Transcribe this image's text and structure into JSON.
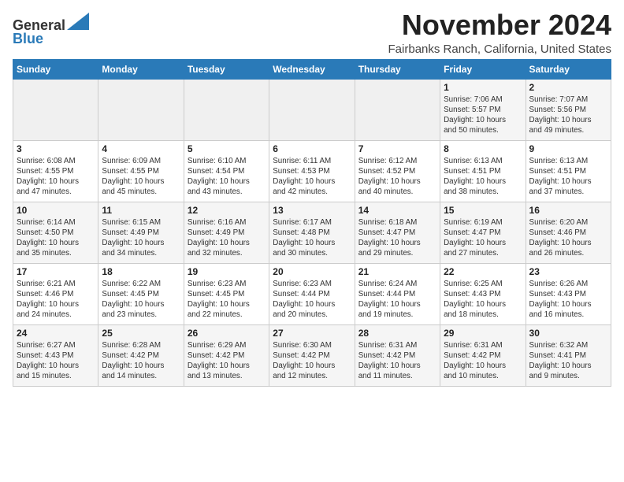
{
  "header": {
    "logo_general": "General",
    "logo_blue": "Blue",
    "month_title": "November 2024",
    "location": "Fairbanks Ranch, California, United States"
  },
  "days_of_week": [
    "Sunday",
    "Monday",
    "Tuesday",
    "Wednesday",
    "Thursday",
    "Friday",
    "Saturday"
  ],
  "weeks": [
    [
      {
        "day": "",
        "info": ""
      },
      {
        "day": "",
        "info": ""
      },
      {
        "day": "",
        "info": ""
      },
      {
        "day": "",
        "info": ""
      },
      {
        "day": "",
        "info": ""
      },
      {
        "day": "1",
        "info": "Sunrise: 7:06 AM\nSunset: 5:57 PM\nDaylight: 10 hours\nand 50 minutes."
      },
      {
        "day": "2",
        "info": "Sunrise: 7:07 AM\nSunset: 5:56 PM\nDaylight: 10 hours\nand 49 minutes."
      }
    ],
    [
      {
        "day": "3",
        "info": "Sunrise: 6:08 AM\nSunset: 4:55 PM\nDaylight: 10 hours\nand 47 minutes."
      },
      {
        "day": "4",
        "info": "Sunrise: 6:09 AM\nSunset: 4:55 PM\nDaylight: 10 hours\nand 45 minutes."
      },
      {
        "day": "5",
        "info": "Sunrise: 6:10 AM\nSunset: 4:54 PM\nDaylight: 10 hours\nand 43 minutes."
      },
      {
        "day": "6",
        "info": "Sunrise: 6:11 AM\nSunset: 4:53 PM\nDaylight: 10 hours\nand 42 minutes."
      },
      {
        "day": "7",
        "info": "Sunrise: 6:12 AM\nSunset: 4:52 PM\nDaylight: 10 hours\nand 40 minutes."
      },
      {
        "day": "8",
        "info": "Sunrise: 6:13 AM\nSunset: 4:51 PM\nDaylight: 10 hours\nand 38 minutes."
      },
      {
        "day": "9",
        "info": "Sunrise: 6:13 AM\nSunset: 4:51 PM\nDaylight: 10 hours\nand 37 minutes."
      }
    ],
    [
      {
        "day": "10",
        "info": "Sunrise: 6:14 AM\nSunset: 4:50 PM\nDaylight: 10 hours\nand 35 minutes."
      },
      {
        "day": "11",
        "info": "Sunrise: 6:15 AM\nSunset: 4:49 PM\nDaylight: 10 hours\nand 34 minutes."
      },
      {
        "day": "12",
        "info": "Sunrise: 6:16 AM\nSunset: 4:49 PM\nDaylight: 10 hours\nand 32 minutes."
      },
      {
        "day": "13",
        "info": "Sunrise: 6:17 AM\nSunset: 4:48 PM\nDaylight: 10 hours\nand 30 minutes."
      },
      {
        "day": "14",
        "info": "Sunrise: 6:18 AM\nSunset: 4:47 PM\nDaylight: 10 hours\nand 29 minutes."
      },
      {
        "day": "15",
        "info": "Sunrise: 6:19 AM\nSunset: 4:47 PM\nDaylight: 10 hours\nand 27 minutes."
      },
      {
        "day": "16",
        "info": "Sunrise: 6:20 AM\nSunset: 4:46 PM\nDaylight: 10 hours\nand 26 minutes."
      }
    ],
    [
      {
        "day": "17",
        "info": "Sunrise: 6:21 AM\nSunset: 4:46 PM\nDaylight: 10 hours\nand 24 minutes."
      },
      {
        "day": "18",
        "info": "Sunrise: 6:22 AM\nSunset: 4:45 PM\nDaylight: 10 hours\nand 23 minutes."
      },
      {
        "day": "19",
        "info": "Sunrise: 6:23 AM\nSunset: 4:45 PM\nDaylight: 10 hours\nand 22 minutes."
      },
      {
        "day": "20",
        "info": "Sunrise: 6:23 AM\nSunset: 4:44 PM\nDaylight: 10 hours\nand 20 minutes."
      },
      {
        "day": "21",
        "info": "Sunrise: 6:24 AM\nSunset: 4:44 PM\nDaylight: 10 hours\nand 19 minutes."
      },
      {
        "day": "22",
        "info": "Sunrise: 6:25 AM\nSunset: 4:43 PM\nDaylight: 10 hours\nand 18 minutes."
      },
      {
        "day": "23",
        "info": "Sunrise: 6:26 AM\nSunset: 4:43 PM\nDaylight: 10 hours\nand 16 minutes."
      }
    ],
    [
      {
        "day": "24",
        "info": "Sunrise: 6:27 AM\nSunset: 4:43 PM\nDaylight: 10 hours\nand 15 minutes."
      },
      {
        "day": "25",
        "info": "Sunrise: 6:28 AM\nSunset: 4:42 PM\nDaylight: 10 hours\nand 14 minutes."
      },
      {
        "day": "26",
        "info": "Sunrise: 6:29 AM\nSunset: 4:42 PM\nDaylight: 10 hours\nand 13 minutes."
      },
      {
        "day": "27",
        "info": "Sunrise: 6:30 AM\nSunset: 4:42 PM\nDaylight: 10 hours\nand 12 minutes."
      },
      {
        "day": "28",
        "info": "Sunrise: 6:31 AM\nSunset: 4:42 PM\nDaylight: 10 hours\nand 11 minutes."
      },
      {
        "day": "29",
        "info": "Sunrise: 6:31 AM\nSunset: 4:42 PM\nDaylight: 10 hours\nand 10 minutes."
      },
      {
        "day": "30",
        "info": "Sunrise: 6:32 AM\nSunset: 4:41 PM\nDaylight: 10 hours\nand 9 minutes."
      }
    ]
  ]
}
